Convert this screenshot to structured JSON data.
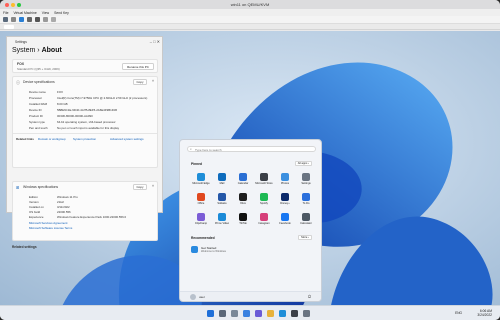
{
  "vm": {
    "window_title": "win11 on QEMU/KVM",
    "menu": [
      "File",
      "Virtual Machine",
      "View",
      "Send Key"
    ],
    "colors": {
      "close": "#ff5f57",
      "min": "#febc2e",
      "max": "#28c840"
    }
  },
  "settings": {
    "window_title": "Settings",
    "breadcrumb_parent": "System",
    "breadcrumb_sep": "›",
    "breadcrumb_current": "About",
    "pc_name": "FOX",
    "pc_model": "Standard PC (Q35 + ICH9, 2009)",
    "rename_button": "Rename this PC",
    "device_section": "Device specifications",
    "copy": "Copy",
    "device_specs": [
      {
        "label": "Device name",
        "value": "FOX"
      },
      {
        "label": "Processor",
        "value": "Intel(R) Core(TM) i7-9750H CPU @ 2.60GHz   2.59 GHz  (2 processors)"
      },
      {
        "label": "Installed RAM",
        "value": "8.00 GB"
      },
      {
        "label": "Device ID",
        "value": "5B8E6C1E-9D4F-4A7B-8EF5-2A6E4F9B1D36"
      },
      {
        "label": "Product ID",
        "value": "00330-80000-00000-AA090"
      },
      {
        "label": "System type",
        "value": "64-bit operating system, x64-based processor"
      },
      {
        "label": "Pen and touch",
        "value": "No pen or touch input is available for this display"
      }
    ],
    "related_links_label": "Related links",
    "related_links": [
      "Domain or workgroup",
      "System protection",
      "Advanced system settings"
    ],
    "windows_section": "Windows specifications",
    "windows_specs": [
      {
        "label": "Edition",
        "value": "Windows 11 Pro"
      },
      {
        "label": "Version",
        "value": "21H2"
      },
      {
        "label": "Installed on",
        "value": "3/11/2022"
      },
      {
        "label": "OS build",
        "value": "22000.556"
      },
      {
        "label": "Experience",
        "value": "Windows Feature Experience Pack 1000.22000.556.0"
      }
    ],
    "agreement_links": [
      "Microsoft Services Agreement",
      "Microsoft Software License Terms"
    ],
    "related_settings": "Related settings"
  },
  "start": {
    "search_placeholder": "Type here to search",
    "pinned_title": "Pinned",
    "all_apps": "All apps  ›",
    "recommended_title": "Recommended",
    "more": "More  ›",
    "apps": [
      {
        "name": "Microsoft Edge",
        "color": "#1f8ed8"
      },
      {
        "name": "Mail",
        "color": "#0f6cbd"
      },
      {
        "name": "Calendar",
        "color": "#2b6fd4"
      },
      {
        "name": "Microsoft Store",
        "color": "#3b3f47"
      },
      {
        "name": "Photos",
        "color": "#3b8fe0"
      },
      {
        "name": "Settings",
        "color": "#6a7482"
      },
      {
        "name": "Office",
        "color": "#e0481f"
      },
      {
        "name": "Solitaire",
        "color": "#2457a8"
      },
      {
        "name": "Xbox",
        "color": "#1e1e1e"
      },
      {
        "name": "Spotify",
        "color": "#1db954"
      },
      {
        "name": "Disney+",
        "color": "#0c2a6b"
      },
      {
        "name": "To Do",
        "color": "#2a6fdc"
      },
      {
        "name": "Clipchamp",
        "color": "#7b5cd6"
      },
      {
        "name": "Prime Video",
        "color": "#1b8ad8"
      },
      {
        "name": "TikTok",
        "color": "#111111"
      },
      {
        "name": "Instagram",
        "color": "#d63f7a"
      },
      {
        "name": "Facebook",
        "color": "#1877f2"
      },
      {
        "name": "Calculator",
        "color": "#4d5864"
      }
    ],
    "recommended": [
      {
        "title": "Get Started",
        "subtitle": "Welcome to Windows"
      }
    ],
    "user": "user",
    "power_icon": "power-icon"
  },
  "tray": {
    "time": "6:06 AM",
    "date": "3/24/2022",
    "lang": "ENG"
  }
}
